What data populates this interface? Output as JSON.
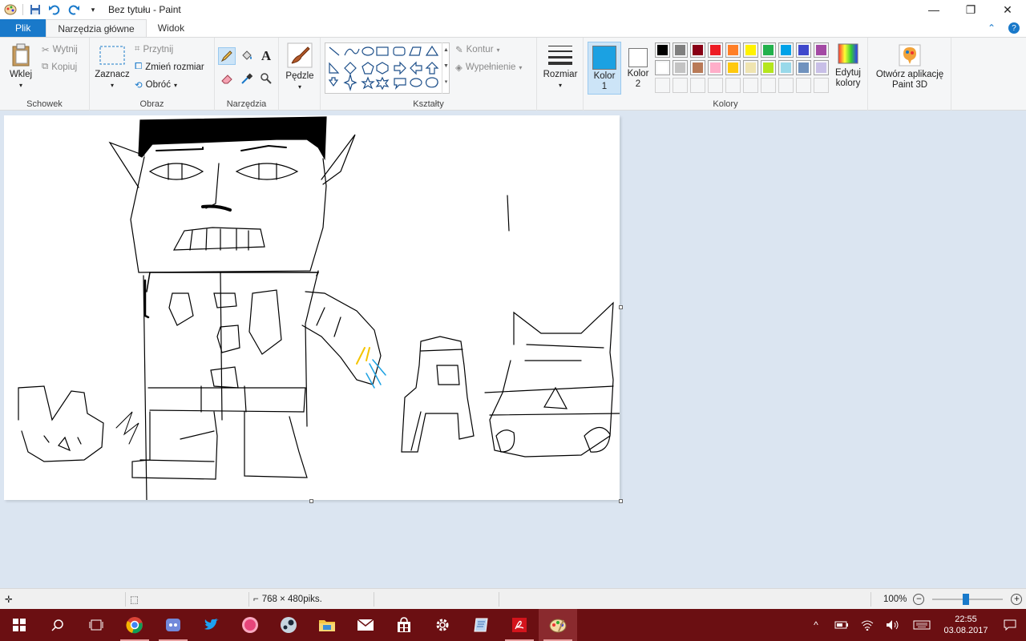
{
  "window": {
    "title": "Bez tytułu - Paint"
  },
  "tabs": {
    "file": "Plik",
    "home": "Narzędzia główne",
    "view": "Widok"
  },
  "clipboard": {
    "paste": "Wklej",
    "cut": "Wytnij",
    "copy": "Kopiuj",
    "group": "Schowek"
  },
  "image": {
    "select": "Zaznacz",
    "crop": "Przytnij",
    "resize": "Zmień rozmiar",
    "rotate": "Obróć",
    "group": "Obraz"
  },
  "tools": {
    "group": "Narzędzia"
  },
  "brushes": {
    "label": "Pędzle"
  },
  "shapes": {
    "outline": "Kontur",
    "fill": "Wypełnienie",
    "group": "Kształty"
  },
  "size": {
    "label": "Rozmiar"
  },
  "colors": {
    "color1_label": "Kolor",
    "color1_num": "1",
    "color2_label": "Kolor",
    "color2_num": "2",
    "edit_line1": "Edytuj",
    "edit_line2": "kolory",
    "group": "Kolory",
    "color1_value": "#1ba1e2",
    "color2_value": "#ffffff",
    "palette_row1": [
      "#000000",
      "#7f7f7f",
      "#880015",
      "#ed1c24",
      "#ff7f27",
      "#fff200",
      "#22b14c",
      "#00a2e8",
      "#3f48cc",
      "#a349a4"
    ],
    "palette_row2": [
      "#ffffff",
      "#c3c3c3",
      "#b97a57",
      "#ffaec9",
      "#ffc90e",
      "#efe4b0",
      "#b5e61d",
      "#99d9ea",
      "#7092be",
      "#c8bfe7"
    ]
  },
  "paint3d": {
    "line1": "Otwórz aplikację",
    "line2": "Paint 3D"
  },
  "statusbar": {
    "dimensions": "768 × 480piks.",
    "zoom": "100%"
  },
  "clock": {
    "time": "22:55",
    "date": "03.08.2017"
  }
}
